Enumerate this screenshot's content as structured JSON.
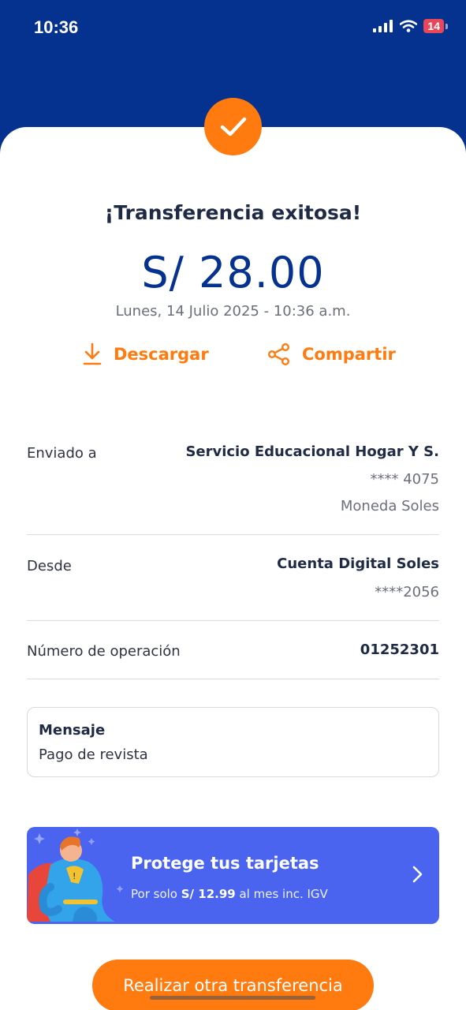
{
  "status_bar": {
    "time": "10:36",
    "battery": "14"
  },
  "header": {
    "title": "¡Transferencia exitosa!",
    "amount": "S/ 28.00",
    "date": "Lunes, 14 Julio 2025 - 10:36 a.m."
  },
  "actions": {
    "download_label": "Descargar",
    "share_label": "Compartir"
  },
  "details": {
    "sent_to": {
      "label": "Enviado a",
      "name": "Servicio Educacional Hogar Y S.",
      "account": "**** 4075",
      "currency": "Moneda Soles"
    },
    "from": {
      "label": "Desde",
      "name": "Cuenta Digital Soles",
      "account": "****2056"
    },
    "operation": {
      "label": "Número de operación",
      "number": "01252301"
    }
  },
  "message": {
    "title": "Mensaje",
    "text": "Pago de revista"
  },
  "promo": {
    "title": "Protege tus tarjetas",
    "sub_prefix": "Por solo",
    "price": "S/ 12.99",
    "sub_suffix": "al mes inc. IGV"
  },
  "cta": {
    "label": "Realizar otra transferencia"
  },
  "colors": {
    "brand_blue": "#05318f",
    "accent_orange": "#ff7a0f",
    "promo_blue": "#4a64f0"
  }
}
